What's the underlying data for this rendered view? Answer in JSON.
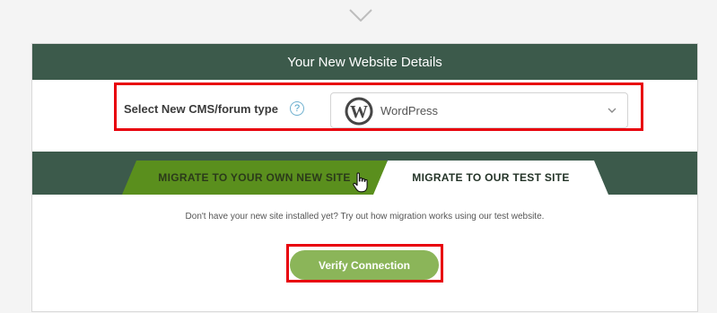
{
  "header": {
    "title": "Your New Website Details"
  },
  "cms": {
    "label": "Select New CMS/forum type",
    "help_icon": "?",
    "selected_value": "WordPress",
    "logo_icon": "wordpress-logo"
  },
  "tabs": [
    {
      "label": "MIGRATE TO YOUR OWN NEW SITE",
      "active": false,
      "color": "#5a8f1d"
    },
    {
      "label": "MIGRATE TO OUR TEST SITE",
      "active": true,
      "color": "#ffffff"
    }
  ],
  "test_site": {
    "info": "Don't have your new site installed yet? Try out how migration works using our test website.",
    "verify_label": "Verify Connection"
  },
  "colors": {
    "header": "#3c5a4b",
    "accent_green": "#8bb559",
    "highlight_red": "#e8000b"
  }
}
